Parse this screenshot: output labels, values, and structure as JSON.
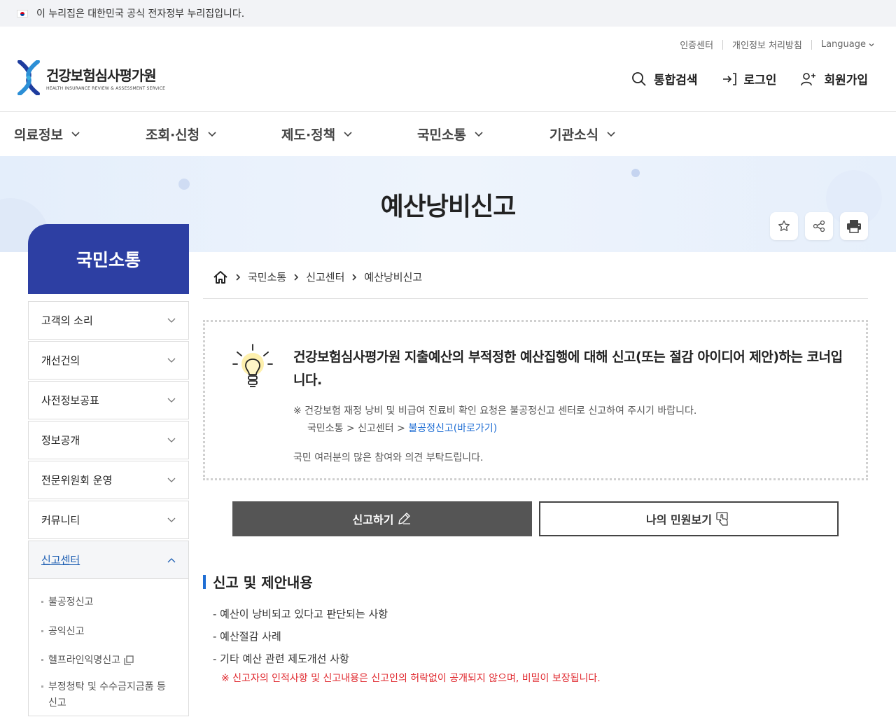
{
  "gov_banner": {
    "text": "이 누리집은 대한민국 공식 전자정부 누리집입니다."
  },
  "util": {
    "cert": "인증센터",
    "privacy": "개인정보 처리방침",
    "language": "Language"
  },
  "logo": {
    "ko": "건강보험심사평가원",
    "en": "HEALTH INSURANCE REVIEW & ASSESSMENT SERVICE"
  },
  "header_actions": {
    "search": "통합검색",
    "login": "로그인",
    "signup": "회원가입"
  },
  "gnb": [
    "의료정보",
    "조회·신청",
    "제도·정책",
    "국민소통",
    "기관소식"
  ],
  "page_title": "예산낭비신고",
  "sidebar": {
    "title": "국민소통",
    "items": [
      "고객의 소리",
      "개선건의",
      "사전정보공표",
      "정보공개",
      "전문위원회 운영",
      "커뮤니티",
      "신고센터"
    ],
    "sub_items": [
      "불공정신고",
      "공익신고",
      "헬프라인익명신고",
      "부정청탁 및 수수금지금품 등 신고"
    ]
  },
  "breadcrumb": [
    "국민소통",
    "신고센터",
    "예산낭비신고"
  ],
  "info": {
    "title": "건강보험심사평가원 지출예산의 부적정한 예산집행에 대해 신고(또는 절감 아이디어 제안)하는 코너입니다.",
    "note": "※ 건강보험 재정 낭비 및 비급여 진료비 확인 요청은 불공정신고 센터로 신고하여 주시기 바랍니다.",
    "path_prefix": "국민소통 > 신고센터 > ",
    "path_link": "불공정신고(바로가기)",
    "request": "국민 여러분의 많은 참여와 의견 부탁드립니다."
  },
  "buttons": {
    "report": "신고하기",
    "my_complaints": "나의 민원보기"
  },
  "section": {
    "title": "신고 및 제안내용",
    "items": [
      "- 예산이 낭비되고 있다고 판단되는 사항",
      "- 예산절감 사례",
      "- 기타 예산 관련 제도개선 사항"
    ],
    "warning": "※ 신고자의 인적사항 및 신고내용은 신고인의 허락없이 공개되지 않으며, 비밀이 보장됩니다."
  },
  "colors": {
    "brand_blue": "#2d3fa3",
    "link_blue": "#1f6ed4",
    "warning_red": "#e0282e",
    "dark_button": "#555555"
  }
}
